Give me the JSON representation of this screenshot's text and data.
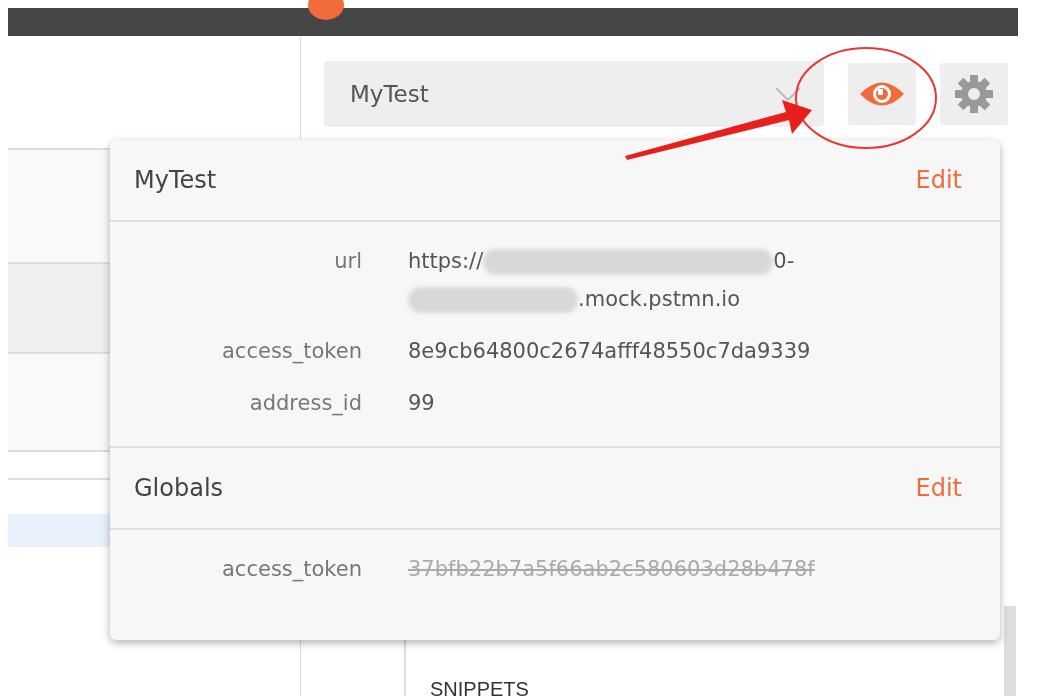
{
  "environment_selector": {
    "value": "MyTest"
  },
  "popup": {
    "sections": [
      {
        "title": "MyTest",
        "action": "Edit",
        "variables": [
          {
            "key": "url",
            "overridden": false,
            "value_segments": [
              {
                "kind": "text",
                "text": "https://"
              },
              {
                "kind": "redacted"
              },
              {
                "kind": "text",
                "text": "0-"
              },
              {
                "kind": "break"
              },
              {
                "kind": "redacted"
              },
              {
                "kind": "text",
                "text": ".mock.pstmn.io"
              }
            ]
          },
          {
            "key": "access_token",
            "overridden": false,
            "value_segments": [
              {
                "kind": "text",
                "text": "8e9cb64800c2674afff48550c7da9339"
              }
            ]
          },
          {
            "key": "address_id",
            "overridden": false,
            "value_segments": [
              {
                "kind": "text",
                "text": "99"
              }
            ]
          }
        ]
      },
      {
        "title": "Globals",
        "action": "Edit",
        "variables": [
          {
            "key": "access_token",
            "overridden": true,
            "value_segments": [
              {
                "kind": "text",
                "text": "37bfb22b7a5f66ab2c580603d28b478f"
              }
            ]
          }
        ]
      }
    ]
  },
  "side_panel": {
    "heading": "SNIPPETS"
  }
}
